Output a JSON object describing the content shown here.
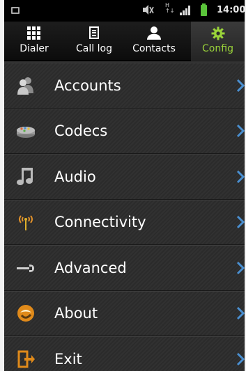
{
  "status_bar": {
    "signal_label": "H",
    "time": "14:00"
  },
  "tabs": [
    {
      "label": "Dialer",
      "icon": "dialpad-icon",
      "selected": false
    },
    {
      "label": "Call log",
      "icon": "call-log-icon",
      "selected": false
    },
    {
      "label": "Contacts",
      "icon": "contacts-icon",
      "selected": false
    },
    {
      "label": "Config",
      "icon": "gear-icon",
      "selected": true
    }
  ],
  "menu": {
    "items": [
      {
        "label": "Accounts",
        "icon": "accounts-icon"
      },
      {
        "label": "Codecs",
        "icon": "codecs-icon"
      },
      {
        "label": "Audio",
        "icon": "music-note-icon"
      },
      {
        "label": "Connectivity",
        "icon": "antenna-icon"
      },
      {
        "label": "Advanced",
        "icon": "wrench-icon"
      },
      {
        "label": "About",
        "icon": "about-icon"
      },
      {
        "label": "Exit",
        "icon": "exit-icon"
      }
    ]
  },
  "colors": {
    "accent": "#9ad33a",
    "chevron": "#4a8fd0",
    "background": "#2f2f2f"
  }
}
